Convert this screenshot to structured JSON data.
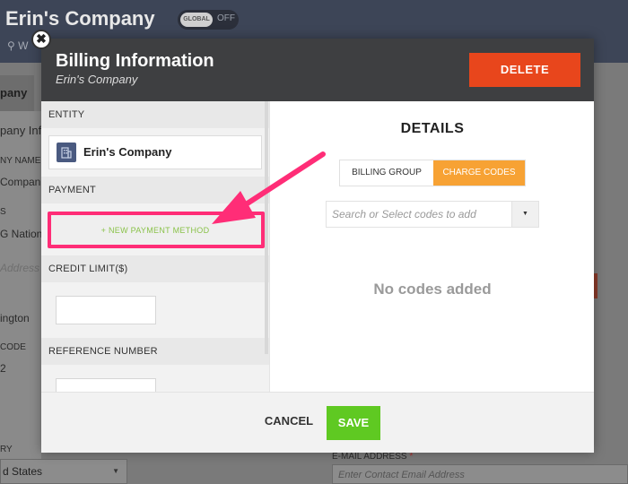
{
  "background": {
    "company_title": "Erin's Company",
    "global_badge": "GLOBAL",
    "global_state": "OFF",
    "location_text": "W",
    "tab_partial": "pany",
    "side_labels": [
      "pany Inf",
      "NY NAME",
      " Compan",
      "S",
      "G Nationa",
      "Address L",
      "ington",
      "CODE",
      "2",
      "RY"
    ],
    "country_value": "d States",
    "email_label": "E-MAIL ADDRESS",
    "email_required": "*",
    "email_placeholder": "Enter Contact Email Address"
  },
  "modal": {
    "title": "Billing Information",
    "subtitle": "Erin's Company",
    "delete_label": "DELETE",
    "close_glyph": "✖",
    "left": {
      "entity_heading": "ENTITY",
      "entity_name": "Erin's Company",
      "payment_heading": "PAYMENT",
      "new_payment_label": "+ NEW PAYMENT METHOD",
      "credit_heading": "CREDIT LIMIT($)",
      "reference_heading": "REFERENCE NUMBER"
    },
    "right": {
      "details_title": "DETAILS",
      "tabs": [
        "BILLING GROUP",
        "CHARGE CODES"
      ],
      "active_tab": "CHARGE CODES",
      "codes_placeholder": "Search or Select codes to add",
      "empty_text": "No codes added"
    },
    "footer": {
      "cancel_label": "CANCEL",
      "save_label": "SAVE"
    }
  },
  "colors": {
    "delete": "#e8461c",
    "save": "#5fc922",
    "active_tab": "#f7a234",
    "new_payment_text": "#8ac24a",
    "annotation": "#ff2d77"
  },
  "icons": {
    "close": "close-icon",
    "entity": "building-icon",
    "location": "location-pin-icon",
    "dropdown": "caret-down-icon"
  }
}
